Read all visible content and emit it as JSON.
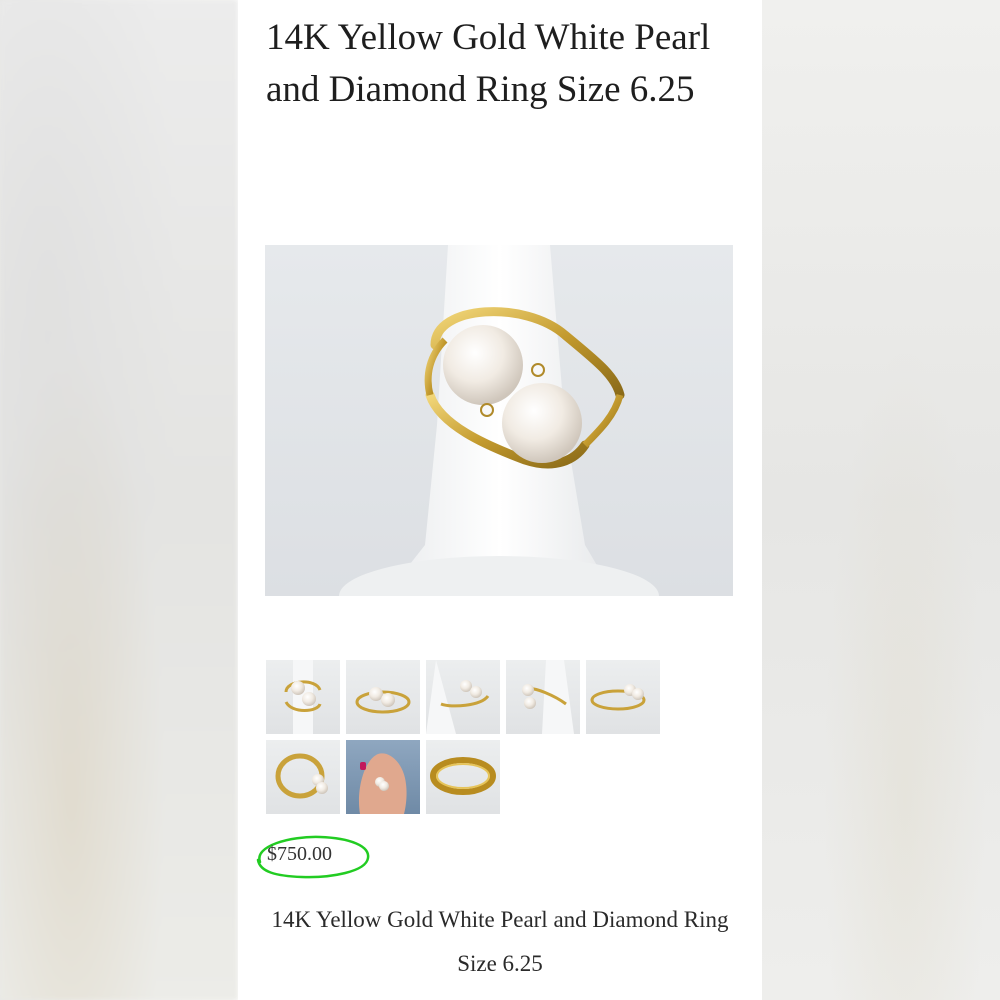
{
  "product": {
    "title": "14K Yellow Gold White Pearl and Diamond Ring Size 6.25",
    "price": "$750.00",
    "caption": "14K Yellow Gold White Pearl and Diamond Ring Size 6.25"
  },
  "gallery": {
    "main_image": "ring-on-display-stand",
    "thumbnails": [
      "ring-front-view",
      "ring-side-view",
      "ring-angle-view",
      "ring-profile-view",
      "ring-flat-view",
      "ring-top-view",
      "ring-on-hand",
      "ring-band-view"
    ]
  },
  "colors": {
    "gold": "#c9a23a",
    "pearl": "#f4eee6",
    "price_highlight": "#22cc22"
  }
}
